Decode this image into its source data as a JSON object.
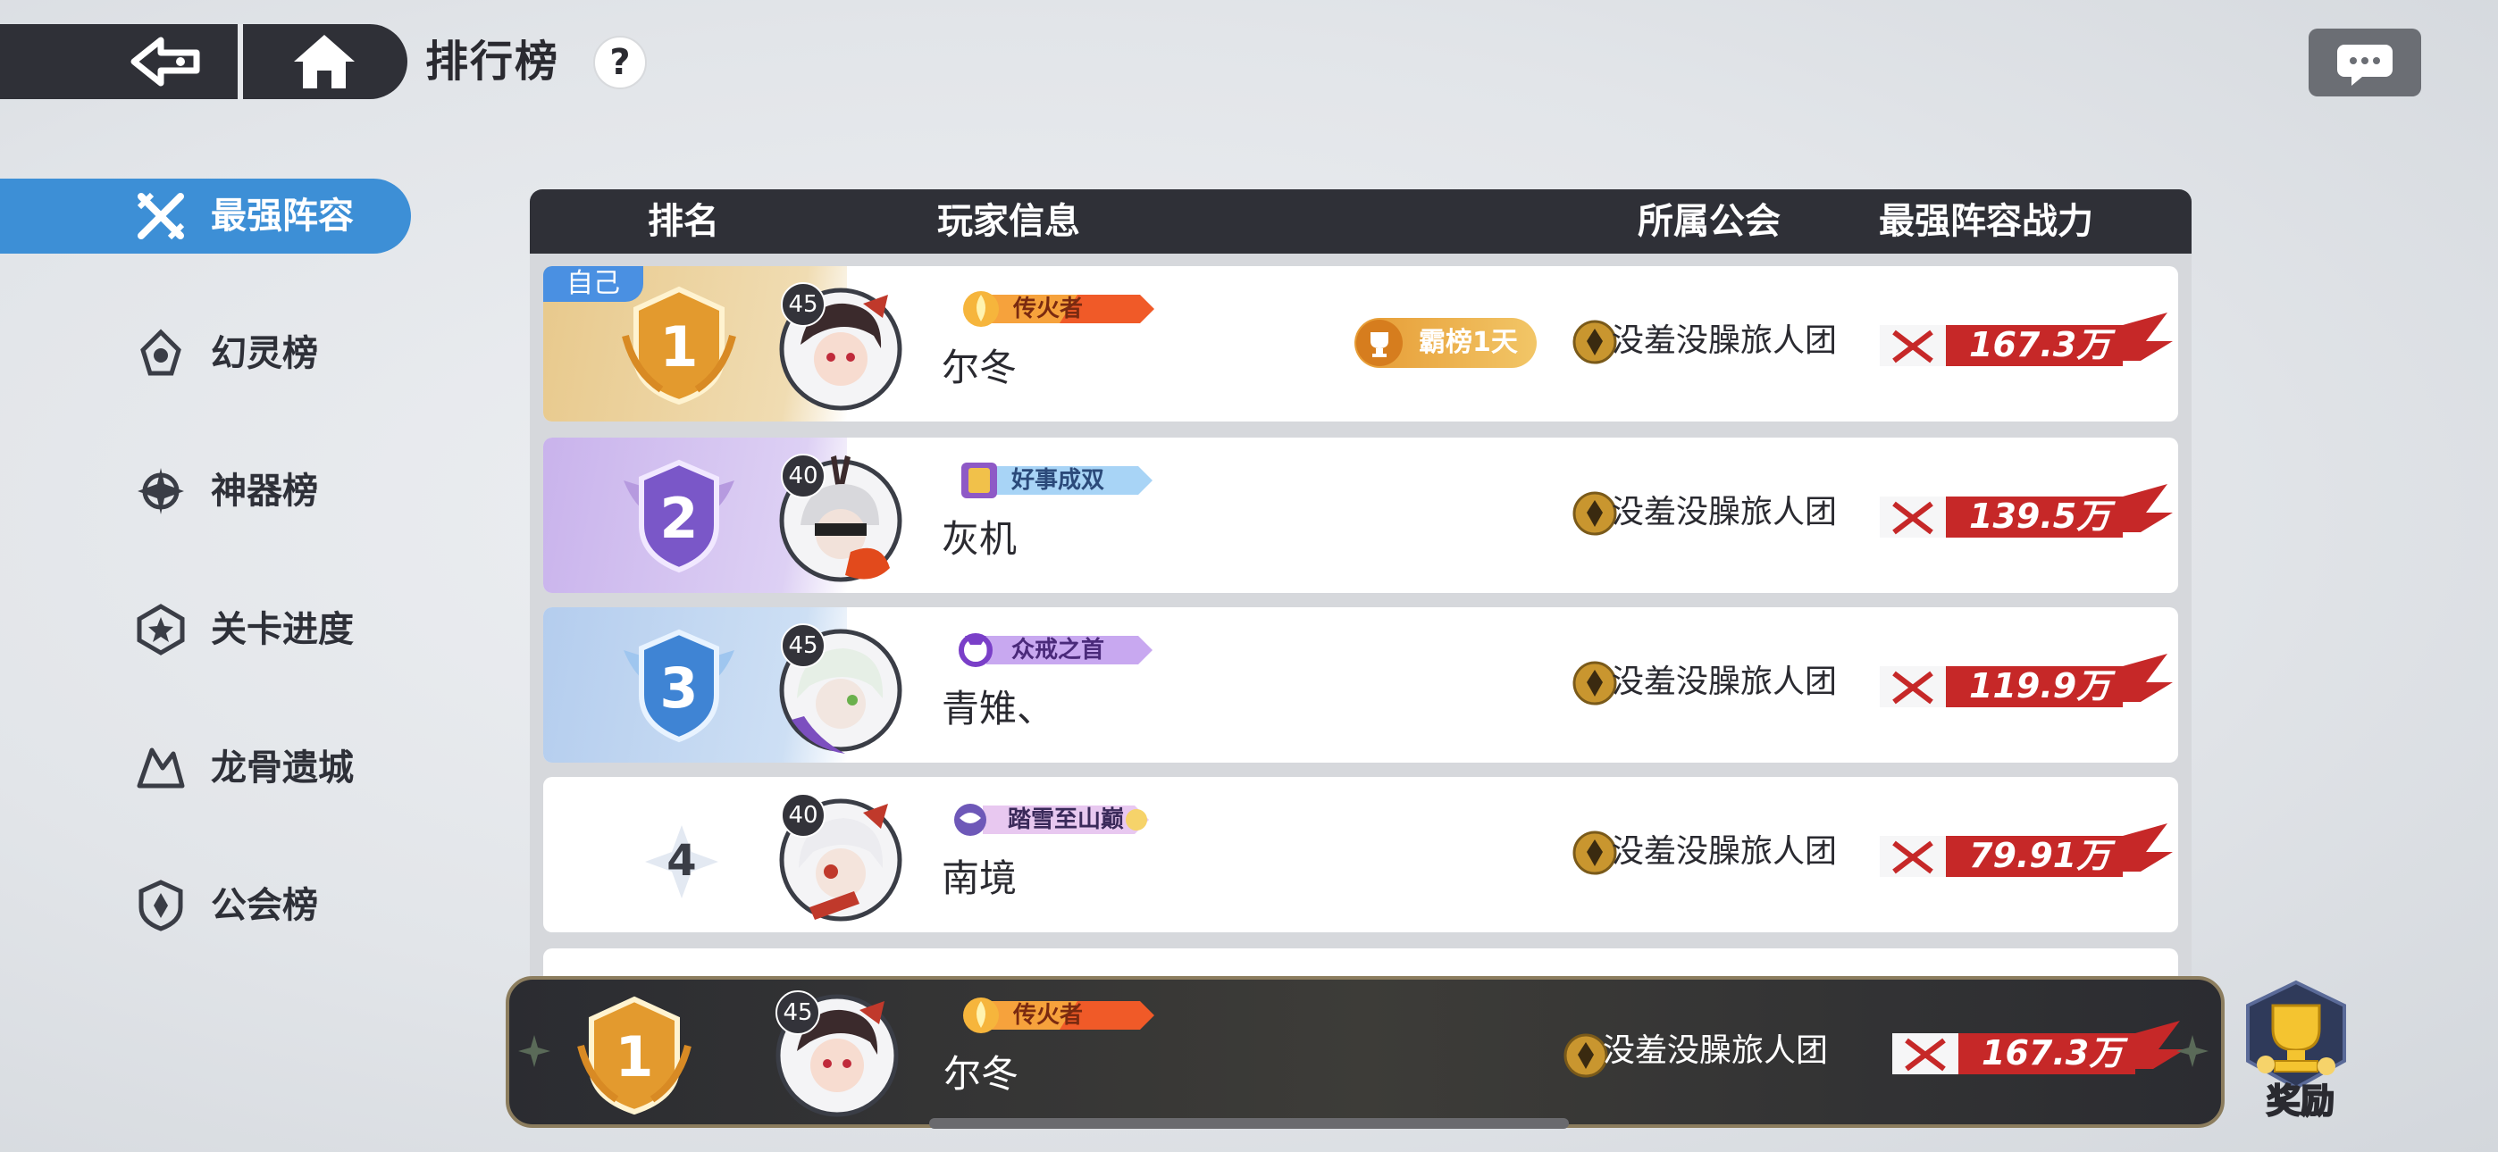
{
  "header": {
    "title": "排行榜",
    "help_label": "?"
  },
  "sidebar": {
    "items": [
      {
        "label": "最强阵容",
        "active": true
      },
      {
        "label": "幻灵榜"
      },
      {
        "label": "神器榜"
      },
      {
        "label": "关卡进度"
      },
      {
        "label": "龙骨遗城"
      },
      {
        "label": "公会榜"
      }
    ]
  },
  "table": {
    "columns": [
      "排名",
      "玩家信息",
      "所属公会",
      "最强阵容战力"
    ],
    "rows": [
      {
        "rank": "1",
        "level": "45",
        "title": "传火者",
        "name": "尔冬",
        "record": "霸榜1天",
        "guild": "没羞没臊旅人团",
        "power": "167.3万",
        "self_tag": "自己"
      },
      {
        "rank": "2",
        "level": "40",
        "title": "好事成双",
        "name": "灰机",
        "guild": "没羞没臊旅人团",
        "power": "139.5万"
      },
      {
        "rank": "3",
        "level": "45",
        "title": "众戒之首",
        "name": "青雉、",
        "guild": "没羞没臊旅人团",
        "power": "119.9万"
      },
      {
        "rank": "4",
        "level": "40",
        "title": "踏雪至山巅",
        "name": "南境",
        "guild": "没羞没臊旅人团",
        "power": "79.91万"
      }
    ]
  },
  "self_bar": {
    "rank": "1",
    "level": "45",
    "title": "传火者",
    "name": "尔冬",
    "guild": "没羞没臊旅人团",
    "power": "167.3万"
  },
  "reward": {
    "label": "奖励"
  },
  "colors": {
    "accent": "#3d8fd6",
    "header_dark": "#2f3037",
    "power_red": "#c62828",
    "gold": "#e69b34"
  }
}
